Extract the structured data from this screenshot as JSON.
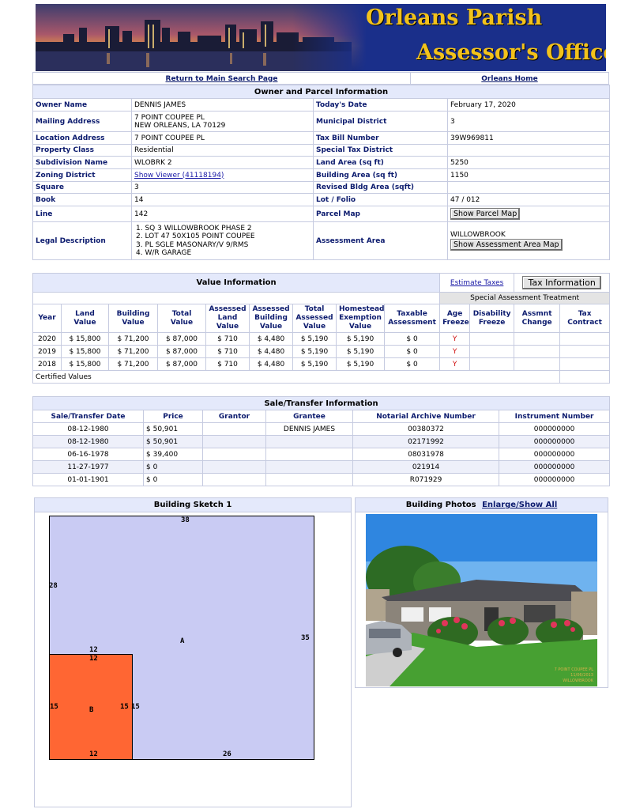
{
  "banner": {
    "line1": "Orleans Parish",
    "line2": "Assessor's Office"
  },
  "nav": {
    "return_label": "Return to Main Search Page",
    "home_label": "Orleans Home"
  },
  "owner": {
    "section_title": "Owner and Parcel Information",
    "owner_name_label": "Owner Name",
    "owner_name": "DENNIS JAMES",
    "todays_date_label": "Today's Date",
    "todays_date": "February 17, 2020",
    "mailing_label": "Mailing Address",
    "mailing_line1": "7 POINT COUPEE PL",
    "mailing_line2": "NEW ORLEANS, LA 70129",
    "municipal_label": "Municipal District",
    "municipal": "3",
    "location_label": "Location Address",
    "location": "7 POINT COUPEE PL",
    "taxbill_label": "Tax Bill Number",
    "taxbill": "39W969811",
    "propclass_label": "Property Class",
    "propclass": "Residential",
    "specialtax_label": "Special Tax District",
    "specialtax": "",
    "subdivision_label": "Subdivision Name",
    "subdivision": "WLOBRK 2",
    "landarea_label": "Land Area (sq ft)",
    "landarea": "5250",
    "zoning_label": "Zoning District",
    "zoning_link": "Show Viewer (41118194)",
    "buildingarea_label": "Building Area (sq ft)",
    "buildingarea": "1150",
    "square_label": "Square",
    "square": "3",
    "revised_label": "Revised Bldg Area (sqft)",
    "revised": "",
    "book_label": "Book",
    "book": "14",
    "lotfolio_label": "Lot / Folio",
    "lotfolio": "47 / 012",
    "line_label": "Line",
    "line": "142",
    "parcelmap_label": "Parcel Map",
    "parcelmap_button": "Show Parcel Map",
    "legal_label": "Legal Description",
    "legal": [
      "1. SQ 3 WILLOWBROOK PHASE 2",
      "2. LOT 47 50X105 POINT COUPEE",
      "3. PL SGLE MASONARY/V 9/RMS",
      "4. W/R GARAGE"
    ],
    "assessment_area_label": "Assessment Area",
    "assessment_area": "WILLOWBROOK",
    "assessment_button": "Show Assessment Area Map"
  },
  "value": {
    "section_title": "Value Information",
    "estimate_link": "Estimate Taxes",
    "tax_button": "Tax Information",
    "special_header": "Special Assessment Treatment",
    "columns": [
      "Year",
      "Land Value",
      "Building Value",
      "Total Value",
      "Assessed Land Value",
      "Assessed Building Value",
      "Total Assessed Value",
      "Homestead Exemption Value",
      "Taxable Assessment",
      "Age Freeze",
      "Disability Freeze",
      "Assmnt Change",
      "Tax Contract"
    ],
    "rows": [
      [
        "2020",
        "$ 15,800",
        "$ 71,200",
        "$ 87,000",
        "$ 710",
        "$ 4,480",
        "$ 5,190",
        "$ 5,190",
        "$ 0",
        "Y",
        "",
        "",
        ""
      ],
      [
        "2019",
        "$ 15,800",
        "$ 71,200",
        "$ 87,000",
        "$ 710",
        "$ 4,480",
        "$ 5,190",
        "$ 5,190",
        "$ 0",
        "Y",
        "",
        "",
        ""
      ],
      [
        "2018",
        "$ 15,800",
        "$ 71,200",
        "$ 87,000",
        "$ 710",
        "$ 4,480",
        "$ 5,190",
        "$ 5,190",
        "$ 0",
        "Y",
        "",
        "",
        ""
      ]
    ],
    "footer": "Certified Values"
  },
  "sales": {
    "section_title": "Sale/Transfer Information",
    "columns": [
      "Sale/Transfer Date",
      "Price",
      "Grantor",
      "Grantee",
      "Notarial Archive Number",
      "Instrument Number"
    ],
    "rows": [
      [
        "08-12-1980",
        "$ 50,901",
        "",
        "DENNIS JAMES",
        "00380372",
        "000000000"
      ],
      [
        "08-12-1980",
        "$ 50,901",
        "",
        "",
        "02171992",
        "000000000"
      ],
      [
        "06-16-1978",
        "$ 39,400",
        "",
        "",
        "08031978",
        "000000000"
      ],
      [
        "11-27-1977",
        "$ 0",
        "",
        "",
        "021914",
        "000000000"
      ],
      [
        "01-01-1901",
        "$ 0",
        "",
        "",
        "R071929",
        "000000000"
      ]
    ]
  },
  "sketch": {
    "title": "Building Sketch 1",
    "labels": {
      "top": "38",
      "left": "28",
      "right": "35",
      "a": "A",
      "b": "B",
      "b_top_outer": "12",
      "b_top_inner": "12",
      "b_left": "15",
      "b_right": "15",
      "a_right_of_b": "15",
      "b_bottom": "12",
      "a_bottom": "26"
    },
    "colors": {
      "area_a": "#c9cbf3",
      "area_b": "#ff6633"
    }
  },
  "photos": {
    "title": "Building Photos",
    "link": "Enlarge/Show All",
    "caption_lines": [
      "7 POINT COUPEE PL",
      "11/06/2013",
      "WILLOWBROOK"
    ]
  }
}
